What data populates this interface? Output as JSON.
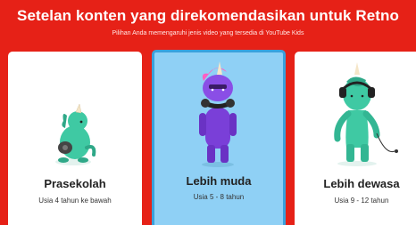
{
  "header": {
    "title": "Setelan konten yang direkomendasikan untuk Retno",
    "subtitle": "Pilihan Anda memengaruhi jenis video yang tersedia di YouTube Kids"
  },
  "cards": [
    {
      "label": "Prasekolah",
      "range": "Usia 4 tahun ke bawah",
      "icon": "baby-unicorn-icon",
      "selected": false
    },
    {
      "label": "Lebih muda",
      "range": "Usia 5 - 8 tahun",
      "icon": "unicorn-headphones-icon",
      "selected": true
    },
    {
      "label": "Lebih dewasa",
      "range": "Usia 9 - 12 tahun",
      "icon": "teen-unicorn-icon",
      "selected": false
    }
  ],
  "colors": {
    "background": "#e62117",
    "selected_card": "#8fd0f5",
    "selected_border": "#3aa1dc"
  }
}
